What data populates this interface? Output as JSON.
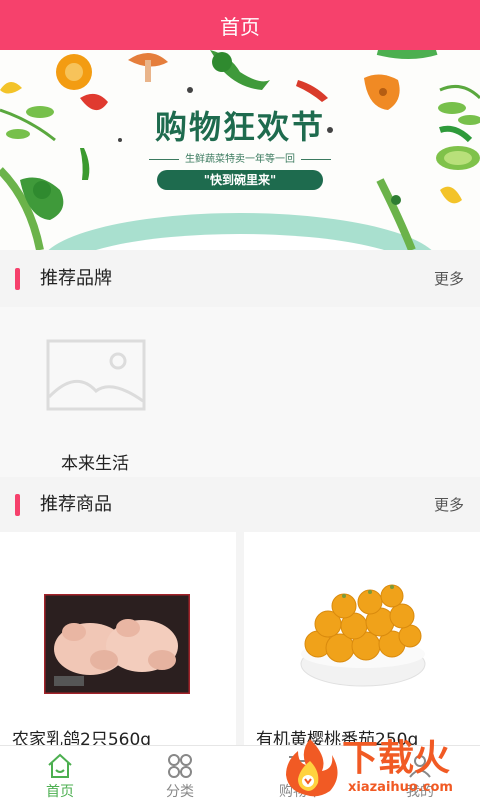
{
  "header": {
    "title": "首页"
  },
  "banner": {
    "title": "购物狂欢节",
    "subtitle": "生鲜蔬菜特卖一年等一回",
    "tag": "\"快到碗里来\""
  },
  "brands_section": {
    "title": "推荐品牌",
    "more": "更多"
  },
  "brands": [
    {
      "name": "本来生活"
    }
  ],
  "goods_section": {
    "title": "推荐商品",
    "more": "更多"
  },
  "goods": [
    {
      "name": "农家乳鸽2只560g"
    },
    {
      "name": "有机黄樱桃番茄250g"
    }
  ],
  "tabbar": [
    {
      "label": "首页",
      "icon": "home-icon",
      "active": true
    },
    {
      "label": "分类",
      "icon": "category-icon",
      "active": false
    },
    {
      "label": "购物车",
      "icon": "cart-icon",
      "active": false
    },
    {
      "label": "我的",
      "icon": "user-icon",
      "active": false
    }
  ],
  "watermark": {
    "text": "下载火",
    "url": "xiazaihuo.com"
  },
  "colors": {
    "brand": "#f6416c",
    "accent_green": "#4caf50",
    "banner_green": "#1e6b4e"
  }
}
